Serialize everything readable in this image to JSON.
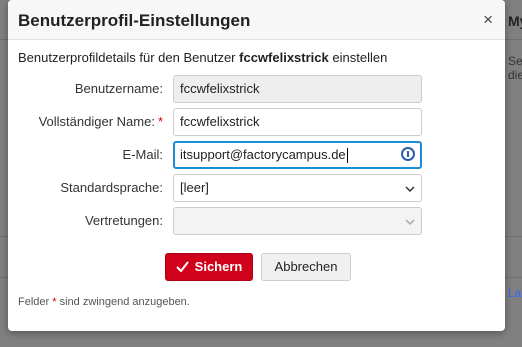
{
  "background": {
    "heading": "My",
    "text": "Se\ndie",
    "link": "La"
  },
  "dialog": {
    "title": "Benutzerprofil-Einstellungen",
    "close_icon": "×",
    "intro_prefix": "Benutzerprofildetails für den Benutzer",
    "intro_user": "fccwfelixstrick",
    "intro_suffix": "einstellen"
  },
  "form": {
    "username": {
      "label": "Benutzername:",
      "value": "fccwfelixstrick"
    },
    "fullname": {
      "label": "Vollständiger Name:",
      "required_mark": "*",
      "value": "fccwfelixstrick"
    },
    "email": {
      "label": "E-Mail:",
      "value": "itsupport@factorycampus.de"
    },
    "language": {
      "label": "Standardsprache:",
      "value": "[leer]"
    },
    "substitutes": {
      "label": "Vertretungen:",
      "value": ""
    }
  },
  "buttons": {
    "save_label": "Sichern",
    "cancel_label": "Abbrechen"
  },
  "footnote": {
    "prefix": "Felder",
    "mark": "*",
    "suffix": "sind zwingend anzugeben."
  },
  "colors": {
    "accent": "#d0021b",
    "focus": "#1a8fd6",
    "required": "#cc0000"
  }
}
